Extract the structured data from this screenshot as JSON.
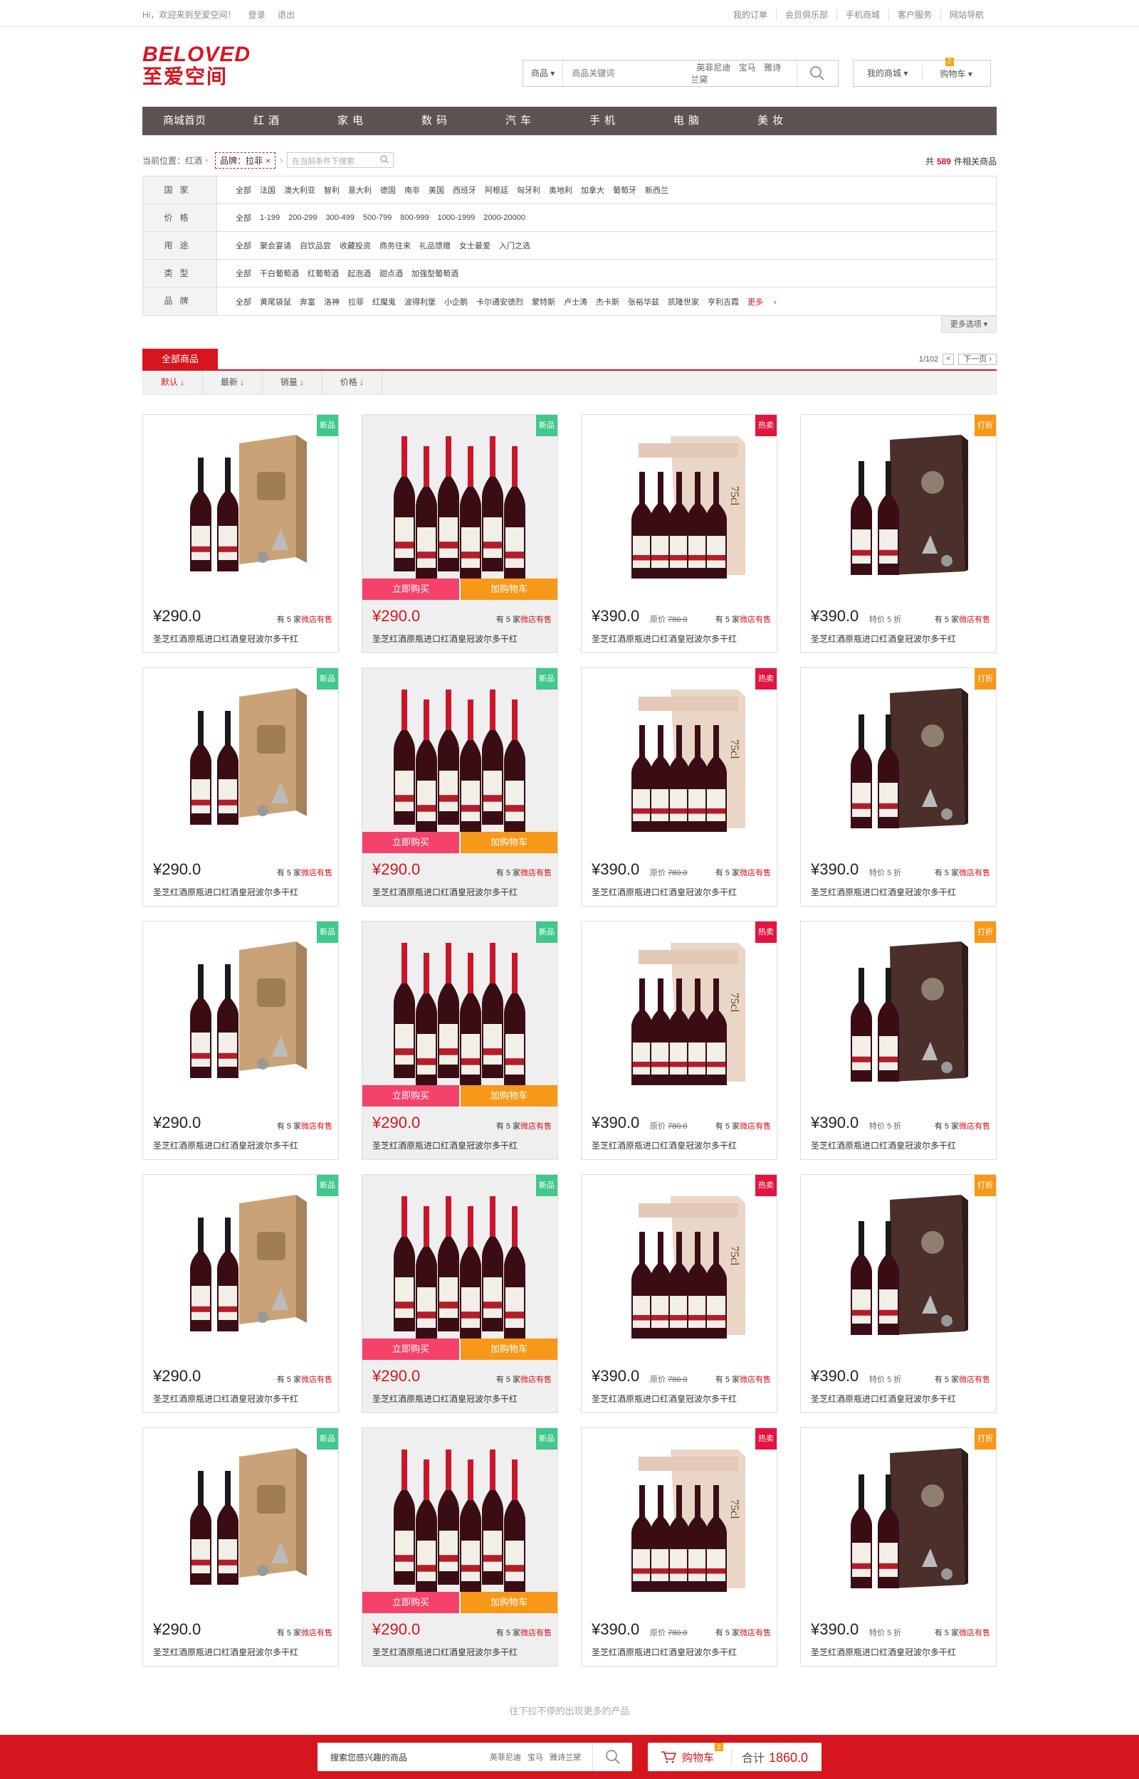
{
  "topbar": {
    "greeting": "Hi，欢迎来到至爱空间！",
    "login": "登录",
    "logout": "退出",
    "links": [
      "我的订单",
      "会员俱乐部",
      "手机商城",
      "客户服务",
      "网站导航"
    ]
  },
  "logo": {
    "en": "BELOVED",
    "cn": "至爱空间"
  },
  "search": {
    "category": "商品",
    "placeholder": "商品关键词",
    "hot": [
      "英菲尼迪",
      "宝马",
      "雅诗兰黛"
    ]
  },
  "account": {
    "mymall": "我的商城",
    "cart": "购物车",
    "cart_count": "2"
  },
  "nav": [
    "商城首页",
    "红酒",
    "家电",
    "数码",
    "汽车",
    "手机",
    "电脑",
    "美妆"
  ],
  "breadcrumb": {
    "prefix": "当前位置：",
    "category": "红酒",
    "filter_tag": "品牌：拉菲",
    "filter_remove": "×",
    "filter_placeholder": "在当前条件下搜索"
  },
  "total": {
    "prefix": "共",
    "count": "589",
    "suffix": "件相关商品"
  },
  "filters": [
    {
      "label": "国家",
      "values": [
        "全部",
        "法国",
        "澳大利亚",
        "智利",
        "意大利",
        "德国",
        "南非",
        "美国",
        "西班牙",
        "阿根廷",
        "匈牙利",
        "奥地利",
        "加拿大",
        "葡萄牙",
        "新西兰"
      ]
    },
    {
      "label": "价格",
      "values": [
        "全部",
        "1-199",
        "200-299",
        "300-499",
        "500-799",
        "800-999",
        "1000-1999",
        "2000-20000"
      ]
    },
    {
      "label": "用途",
      "values": [
        "全部",
        "聚会宴请",
        "自饮品尝",
        "收藏投资",
        "商务往来",
        "礼品馈赠",
        "女士最爱",
        "入门之选"
      ]
    },
    {
      "label": "类型",
      "values": [
        "全部",
        "干白葡萄酒",
        "红葡萄酒",
        "起泡酒",
        "甜点酒",
        "加强型葡萄酒"
      ]
    },
    {
      "label": "品牌",
      "values": [
        "全部",
        "黄尾袋鼠",
        "奔富",
        "洛神",
        "拉菲",
        "红魔鬼",
        "波得利堡",
        "小企鹅",
        "卡尔通安德烈",
        "蒙特斯",
        "卢士涛",
        "杰卡斯",
        "张裕华兹",
        "凯隆世家",
        "亨利吉霞"
      ],
      "more": "更多"
    }
  ],
  "more_options": "更多选项",
  "tabs": {
    "all": "全部商品",
    "page": "1/102",
    "prev": "<",
    "next": "下一页"
  },
  "sort": [
    "默认",
    "最新",
    "销量",
    "价格"
  ],
  "columns": [
    {
      "flag": "新品",
      "flag_color": "#41c88c",
      "price": "¥290.0",
      "old": "",
      "shops_pre": "有 5 家",
      "shops_post": "微店有售",
      "title": "圣芝红酒原瓶进口红酒皇冠波尔多干红",
      "style": "box-tan"
    },
    {
      "flag": "新品",
      "flag_color": "#41c88c",
      "price": "¥290.0",
      "old": "",
      "shops_pre": "有 5 家",
      "shops_post": "微店有售",
      "title": "圣芝红酒原瓶进口红酒皇冠波尔多干红",
      "style": "six",
      "buy": "立即购买",
      "cart": "加购物车"
    },
    {
      "flag": "热卖",
      "flag_color": "#e3143f",
      "price": "¥390.0",
      "old_label": "原价",
      "old": "780.0",
      "shops_pre": "有 5 家",
      "shops_post": "微店有售",
      "title": "圣芝红酒原瓶进口红酒皇冠波尔多干红",
      "style": "crate"
    },
    {
      "flag": "打折",
      "flag_color": "#f79818",
      "price": "¥390.0",
      "old_label": "特价",
      "old": "5 折",
      "shops_pre": "有 5 家",
      "shops_post": "微店有售",
      "title": "圣芝红酒原瓶进口红酒皇冠波尔多干红",
      "style": "box-dark"
    }
  ],
  "footer": {
    "loadmore": "往下拉不停的出现更多的产品",
    "search_text": "搜索您感兴趣的商品",
    "hot": [
      "英菲尼迪",
      "宝马",
      "雅诗兰黛"
    ],
    "cart": "购物车",
    "cart_count": "2",
    "total_label": "合计",
    "total": "1860.0"
  },
  "colors": {
    "brand": "#d7151f",
    "nav": "#5d5352"
  }
}
